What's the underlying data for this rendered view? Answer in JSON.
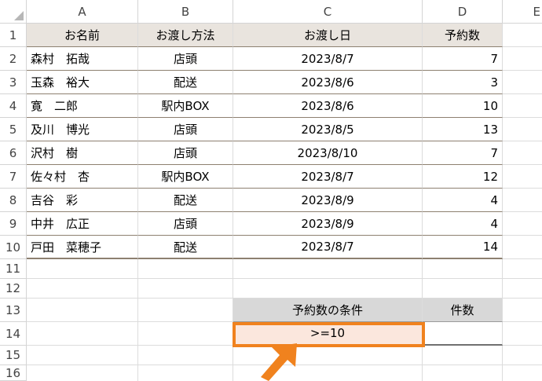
{
  "columns": [
    "A",
    "B",
    "C",
    "D",
    "E"
  ],
  "rows": [
    "1",
    "2",
    "3",
    "4",
    "5",
    "6",
    "7",
    "8",
    "9",
    "10",
    "11",
    "12",
    "13",
    "14",
    "15",
    "16"
  ],
  "table": {
    "headers": [
      "お名前",
      "お渡し方法",
      "お渡し日",
      "予約数"
    ],
    "records": [
      {
        "name": "森村　拓哉",
        "method": "店頭",
        "date": "2023/8/7",
        "count": "7"
      },
      {
        "name": "玉森　裕大",
        "method": "配送",
        "date": "2023/8/6",
        "count": "3"
      },
      {
        "name": "寛　二郎",
        "method": "駅内BOX",
        "date": "2023/8/6",
        "count": "10"
      },
      {
        "name": "及川　博光",
        "method": "店頭",
        "date": "2023/8/5",
        "count": "13"
      },
      {
        "name": "沢村　樹",
        "method": "店頭",
        "date": "2023/8/10",
        "count": "7"
      },
      {
        "name": "佐々村　杏",
        "method": "駅内BOX",
        "date": "2023/8/7",
        "count": "12"
      },
      {
        "name": "吉谷　彩",
        "method": "配送",
        "date": "2023/8/9",
        "count": "4"
      },
      {
        "name": "中井　広正",
        "method": "店頭",
        "date": "2023/8/9",
        "count": "4"
      },
      {
        "name": "戸田　菜穂子",
        "method": "配送",
        "date": "2023/8/7",
        "count": "14"
      }
    ]
  },
  "criteria": {
    "header": "予約数の条件",
    "value": ">=10",
    "count_header": "件数",
    "count_value": ""
  },
  "colors": {
    "header_fill": "#e9e4de",
    "criteria_header_fill": "#d8d8d8",
    "highlight_fill": "#fbe7dd",
    "accent": "#f0821e"
  },
  "icons": {
    "arrow": "orange-arrow-icon",
    "select_all": "select-all-icon"
  }
}
